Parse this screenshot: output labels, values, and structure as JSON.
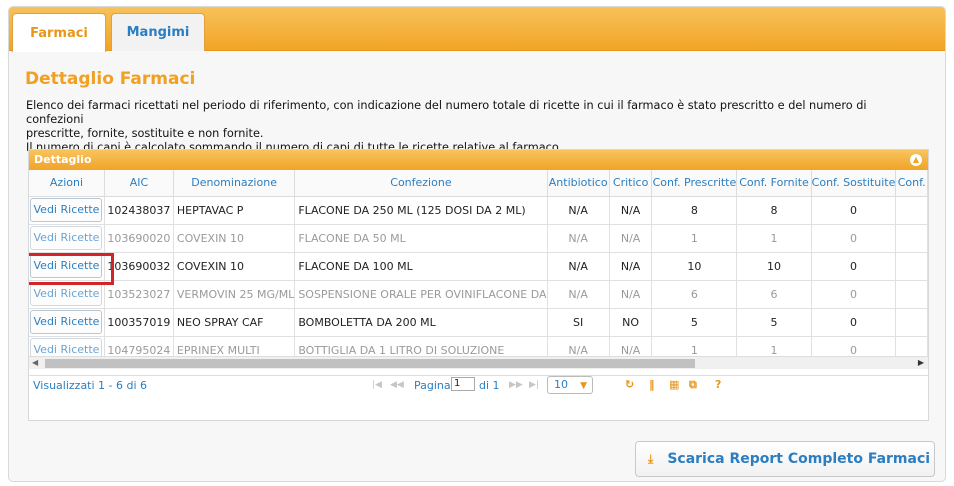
{
  "tabs": [
    {
      "label": "Farmaci",
      "active": true
    },
    {
      "label": "Mangimi",
      "active": false
    }
  ],
  "section": {
    "title": "Dettaglio Farmaci",
    "description_line1": "Elenco dei farmaci ricettati nel periodo di riferimento, con indicazione del numero totale di ricette in cui il farmaco è stato prescritto e del numero di confezioni",
    "description_line2": "prescritte, fornite, sostituite e non fornite.",
    "description_line3": "Il numero di capi è calcolato sommando il numero di capi di tutte le ricette relative al farmaco."
  },
  "grid": {
    "caption": "Dettaglio",
    "columns": [
      "Azioni",
      "AIC",
      "Denominazione",
      "Confezione",
      "Antibiotico",
      "Critico",
      "Conf. Prescritte",
      "Conf. Fornite",
      "Conf. Sostituite",
      "Conf."
    ],
    "action_label": "Vedi Ricette",
    "rows": [
      {
        "aic": "102438037",
        "denominazione": "HEPTAVAC P",
        "confezione": "FLACONE DA 250 ML (125 DOSI DA 2 ML)",
        "antibiotico": "N/A",
        "critico": "N/A",
        "prescritte": "8",
        "fornite": "8",
        "sostituite": "0",
        "dim": false
      },
      {
        "aic": "103690020",
        "denominazione": "COVEXIN 10",
        "confezione": "FLACONE DA 50 ML",
        "antibiotico": "N/A",
        "critico": "N/A",
        "prescritte": "1",
        "fornite": "1",
        "sostituite": "0",
        "dim": true
      },
      {
        "aic": "103690032",
        "denominazione": "COVEXIN 10",
        "confezione": "FLACONE DA 100 ML",
        "antibiotico": "N/A",
        "critico": "N/A",
        "prescritte": "10",
        "fornite": "10",
        "sostituite": "0",
        "dim": false
      },
      {
        "aic": "103523027",
        "denominazione": "VERMOVIN 25 MG/ML",
        "confezione": "SOSPENSIONE ORALE PER OVINIFLACONE DA",
        "antibiotico": "N/A",
        "critico": "N/A",
        "prescritte": "6",
        "fornite": "6",
        "sostituite": "0",
        "dim": true
      },
      {
        "aic": "100357019",
        "denominazione": "NEO SPRAY CAF",
        "confezione": "BOMBOLETTA DA 200 ML",
        "antibiotico": "SI",
        "critico": "NO",
        "prescritte": "5",
        "fornite": "5",
        "sostituite": "0",
        "dim": false
      },
      {
        "aic": "104795024",
        "denominazione": "EPRINEX MULTI",
        "confezione": "BOTTIGLIA DA 1 LITRO DI SOLUZIONE",
        "antibiotico": "N/A",
        "critico": "N/A",
        "prescritte": "1",
        "fornite": "1",
        "sostituite": "0",
        "dim": true
      }
    ],
    "highlighted_row_index": 2
  },
  "pager": {
    "info": "Visualizzati 1 - 6 di 6",
    "page_label": "Pagina",
    "page_value": "1",
    "of_label": "di 1",
    "page_size": "10",
    "icons": [
      "first-page-icon",
      "prev-page-icon",
      "next-page-icon",
      "last-page-icon",
      "refresh-icon",
      "columns-icon",
      "export-icon",
      "popout-icon",
      "help-icon"
    ]
  },
  "report_button": {
    "label": "Scarica Report Completo Farmaci",
    "icon": "download-icon"
  },
  "colors": {
    "accent_orange": "#f1a327",
    "link_blue": "#2b7ec1",
    "highlight_red": "#d3242a"
  }
}
